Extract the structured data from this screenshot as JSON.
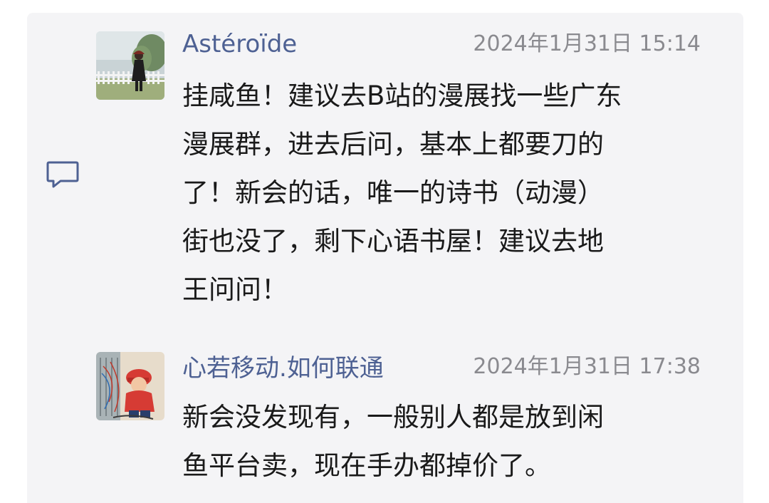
{
  "comments": [
    {
      "author": "Astéroïde",
      "timestamp": "2024年1月31日 15:14",
      "lines": [
        "挂咸鱼！建议去B站的漫展找一些广东",
        "漫展群，进去后问，基本上都要刀的",
        "了！新会的话，唯一的诗书（动漫）",
        "街也没了，剩下心语书屋！建议去地",
        "王问问！"
      ]
    },
    {
      "author": "心若移动.如何联通",
      "timestamp": "2024年1月31日 17:38",
      "lines": [
        "新会没发现有，一般别人都是放到闲",
        "鱼平台卖，现在手办都掉价了。"
      ]
    }
  ],
  "icons": {
    "comment": "comment-bubble-icon"
  },
  "colors": {
    "author": "#4e6193",
    "timestamp": "#8a8a8f",
    "text": "#1a1a1a",
    "panel": "#f4f4f6"
  }
}
